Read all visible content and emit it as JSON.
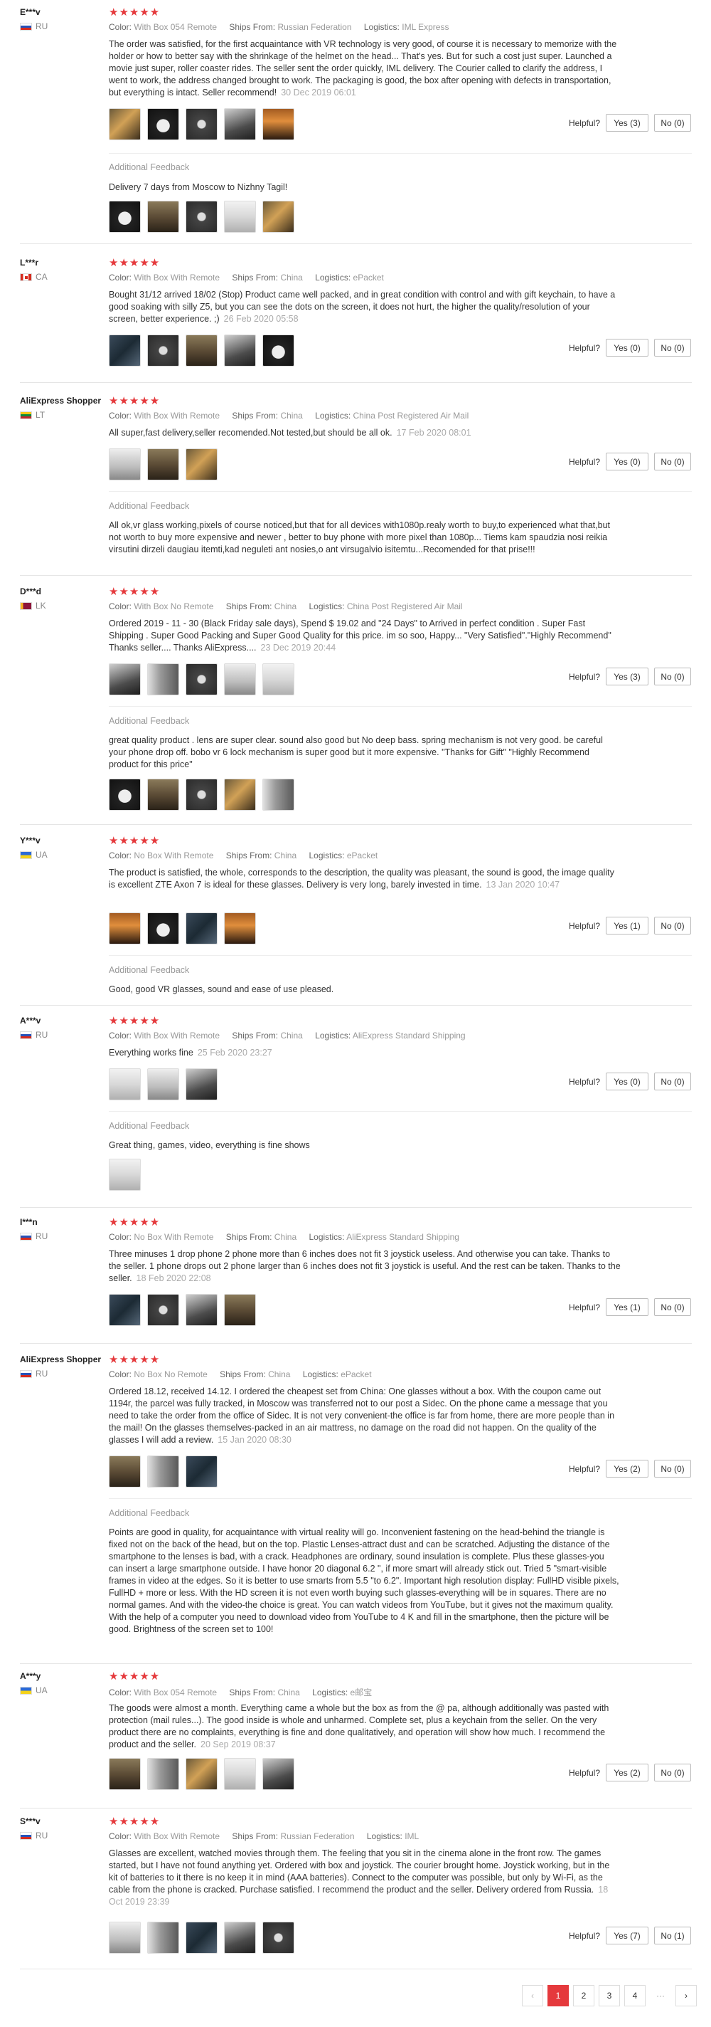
{
  "labels": {
    "color": "Color:",
    "ships_from": "Ships From:",
    "logistics": "Logistics:",
    "helpful": "Helpful?",
    "additional_feedback": "Additional Feedback",
    "stars": "★★★★★"
  },
  "reviews": [
    {
      "user": "E***v",
      "country": "RU",
      "color": "With Box 054 Remote",
      "ships_from": "Russian Federation",
      "logistics": "IML Express",
      "text": "The order was satisfied, for the first acquaintance with VR technology is very good, of course it is necessary to memorize with the holder or how to better say with the shrinkage of the helmet on the head... That's yes. But for such a cost just super. Launched a movie just super, roller coaster rides. The seller sent the order quickly, IML delivery. The Courier called to clarify the address, I went to work, the address changed brought to work. The packaging is good, the box after opening with defects in transportation, but everything is intact. Seller recommend!",
      "date": "30 Dec 2019 06:01",
      "yes": "Yes (3)",
      "no": "No (0)",
      "additional": "Delivery 7 days from Moscow to Nizhny Tagil!"
    },
    {
      "user": "L***r",
      "country": "CA",
      "color": "With Box With Remote",
      "ships_from": "China",
      "logistics": "ePacket",
      "text": "Bought 31/12 arrived 18/02 (Stop) Product came well packed, and in great condition with control and with gift keychain, to have a good soaking with silly Z5, but you can see the dots on the screen, it does not hurt, the higher the quality/resolution of your screen, better experience. ;)",
      "date": "26 Feb 2020 05:58",
      "yes": "Yes (0)",
      "no": "No (0)"
    },
    {
      "user": "AliExpress Shopper",
      "country": "LT",
      "color": "With Box With Remote",
      "ships_from": "China",
      "logistics": "China Post Registered Air Mail",
      "text": "All super,fast delivery,seller recomended.Not tested,but should be all ok.",
      "date": "17 Feb 2020 08:01",
      "yes": "Yes (0)",
      "no": "No (0)",
      "additional": "All ok,vr glass working,pixels of course noticed,but that for all devices with1080p.realy worth to buy,to experienced what that,but not worth to buy more expensive and newer , better to buy phone with more pixel than 1080p... Tiems kam spaudzia nosi reikia virsutini dirzeli daugiau itemti,kad neguleti ant nosies,o ant virsugalvio isitemtu...Recomended for that prise!!!"
    },
    {
      "user": "D***d",
      "country": "LK",
      "color": "With Box No Remote",
      "ships_from": "China",
      "logistics": "China Post Registered Air Mail",
      "text": "Ordered 2019 - 11 - 30 (Black Friday sale days), Spend $ 19.02 and \"24 Days\" to Arrived in perfect condition . Super Fast Shipping . Super Good Packing and Super Good Quality for this price. im so soo, Happy... \"Very Satisfied\".\"Highly Recommend\" Thanks seller.... Thanks AliExpress....",
      "date": "23 Dec 2019 20:44",
      "yes": "Yes (3)",
      "no": "No (0)",
      "additional": "great quality product . lens are super clear. sound also good but No deep bass. spring mechanism is not very good. be careful your phone drop off. bobo vr 6 lock mechanism is super good but it more expensive. \"Thanks for Gift\" \"Highly Recommend product for this price\""
    },
    {
      "user": "Y***v",
      "country": "UA",
      "color": "No Box With Remote",
      "ships_from": "China",
      "logistics": "ePacket",
      "text": "The product is satisfied, the whole, corresponds to the description, the quality was pleasant, the sound is good, the image quality is excellent ZTE Axon 7 is ideal for these glasses. Delivery is very long, barely invested in time.",
      "date": "13 Jan 2020 10:47",
      "yes": "Yes (1)",
      "no": "No (0)",
      "additional": "Good, good VR glasses, sound and ease of use pleased."
    },
    {
      "user": "A***v",
      "country": "RU",
      "color": "With Box With Remote",
      "ships_from": "China",
      "logistics": "AliExpress Standard Shipping",
      "text": "Everything works fine",
      "date": "25 Feb 2020 23:27",
      "yes": "Yes (0)",
      "no": "No (0)",
      "additional": "Great thing, games, video, everything is fine shows"
    },
    {
      "user": "I***n",
      "country": "RU",
      "color": "No Box With Remote",
      "ships_from": "China",
      "logistics": "AliExpress Standard Shipping",
      "text": "Three minuses 1 drop phone 2 phone more than 6 inches does not fit 3 joystick useless. And otherwise you can take. Thanks to the seller. 1 phone drops out 2 phone larger than 6 inches does not fit 3 joystick is useful. And the rest can be taken. Thanks to the seller.",
      "date": "18 Feb 2020 22:08",
      "yes": "Yes (1)",
      "no": "No (0)"
    },
    {
      "user": "AliExpress Shopper",
      "country": "RU",
      "color": "No Box No Remote",
      "ships_from": "China",
      "logistics": "ePacket",
      "text": "Ordered 18.12, received 14.12. I ordered the cheapest set from China: One glasses without a box. With the coupon came out 1194r, the parcel was fully tracked, in Moscow was transferred not to our post a Sidec. On the phone came a message that you need to take the order from the office of Sidec. It is not very convenient-the office is far from home, there are more people than in the mail! On the glasses themselves-packed in an air mattress, no damage on the road did not happen. On the quality of the glasses I will add a review.",
      "date": "15 Jan 2020 08:30",
      "yes": "Yes (2)",
      "no": "No (0)",
      "additional": "Points are good in quality, for acquaintance with virtual reality will go. Inconvenient fastening on the head-behind the triangle is fixed not on the back of the head, but on the top. Plastic Lenses-attract dust and can be scratched. Adjusting the distance of the smartphone to the lenses is bad, with a crack. Headphones are ordinary, sound insulation is complete. Plus these glasses-you can insert a large smartphone outside. I have honor 20 diagonal 6.2 \", if more smart will already stick out. Tried 5 \"smart-visible frames in video at the edges. So it is better to use smarts from 5.5 \"to 6.2\". Important high resolution display: FullHD visible pixels, FullHD + more or less. With the HD screen it is not even worth buying such glasses-everything will be in squares. There are no normal games. And with the video-the choice is great. You can watch videos from YouTube, but it gives not the maximum quality. With the help of a computer you need to download video from YouTube to 4 K and fill in the smartphone, then the picture will be good. Brightness of the screen set to 100!"
    },
    {
      "user": "A***y",
      "country": "UA",
      "color": "With Box 054 Remote",
      "ships_from": "China",
      "logistics": "e邮宝",
      "text": "The goods were almost a month. Everything came a whole but the box as from the @ pa, although additionally was pasted with protection (mail rules...). The good inside is whole and unharmed. Complete set, plus a keychain from the seller. On the very product there are no complaints, everything is fine and done qualitatively, and operation will show how much. I recommend the product and the seller.",
      "date": "20 Sep 2019 08:37",
      "yes": "Yes (2)",
      "no": "No (0)"
    },
    {
      "user": "S***v",
      "country": "RU",
      "color": "With Box With Remote",
      "ships_from": "Russian Federation",
      "logistics": "IML",
      "text": "Glasses are excellent, watched movies through them. The feeling that you sit in the cinema alone in the front row. The games started, but I have not found anything yet. Ordered with box and joystick. The courier brought home. Joystick working, but in the kit of batteries to it there is no keep it in mind (AAA batteries). Connect to the computer was possible, but only by Wi-Fi, as the cable from the phone is cracked. Purchase satisfied. I recommend the product and the seller. Delivery ordered from Russia.",
      "date": "18 Oct 2019 23:39",
      "yes": "Yes (7)",
      "no": "No (1)"
    }
  ],
  "pagination": {
    "prev": "‹",
    "pages": [
      "1",
      "2",
      "3",
      "4"
    ],
    "ellipsis": "···",
    "next": "›"
  }
}
